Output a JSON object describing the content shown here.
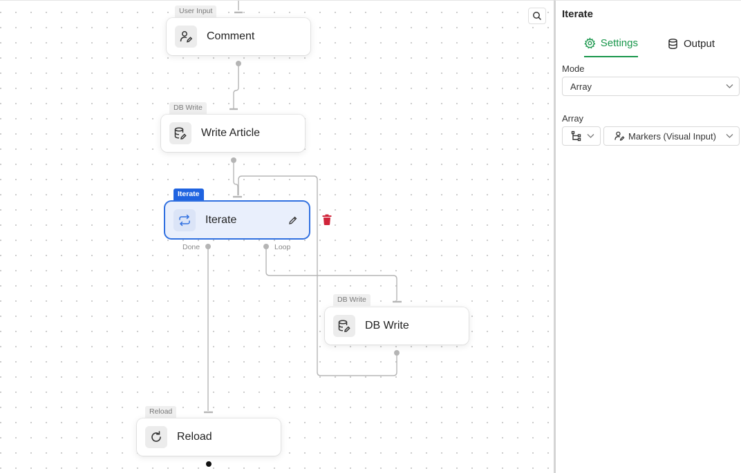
{
  "canvas": {
    "nodes": {
      "comment": {
        "tag": "User Input",
        "label": "Comment",
        "icon": "user-edit-icon"
      },
      "write_article": {
        "tag": "DB Write",
        "label": "Write Article",
        "icon": "database-edit-icon"
      },
      "iterate": {
        "tag": "Iterate",
        "label": "Iterate",
        "icon": "repeat-icon",
        "ports": {
          "done": "Done",
          "loop": "Loop"
        }
      },
      "db_write": {
        "tag": "DB Write",
        "label": "DB Write",
        "icon": "database-edit-icon"
      },
      "reload": {
        "tag": "Reload",
        "label": "Reload",
        "icon": "reload-icon"
      }
    },
    "colors": {
      "selected_border": "#2f6fe0",
      "delete": "#d0243a",
      "wire": "#b5b5b5"
    }
  },
  "panel": {
    "title": "Iterate",
    "tabs": [
      {
        "label": "Settings",
        "icon": "gear-icon",
        "active": true
      },
      {
        "label": "Output",
        "icon": "database-icon",
        "active": false
      }
    ],
    "mode": {
      "label": "Mode",
      "value": "Array"
    },
    "array": {
      "label": "Array",
      "source_icon": "tree-icon",
      "value": "Markers (Visual Input)",
      "value_icon": "user-edit-icon"
    },
    "accent": "#17964a"
  }
}
